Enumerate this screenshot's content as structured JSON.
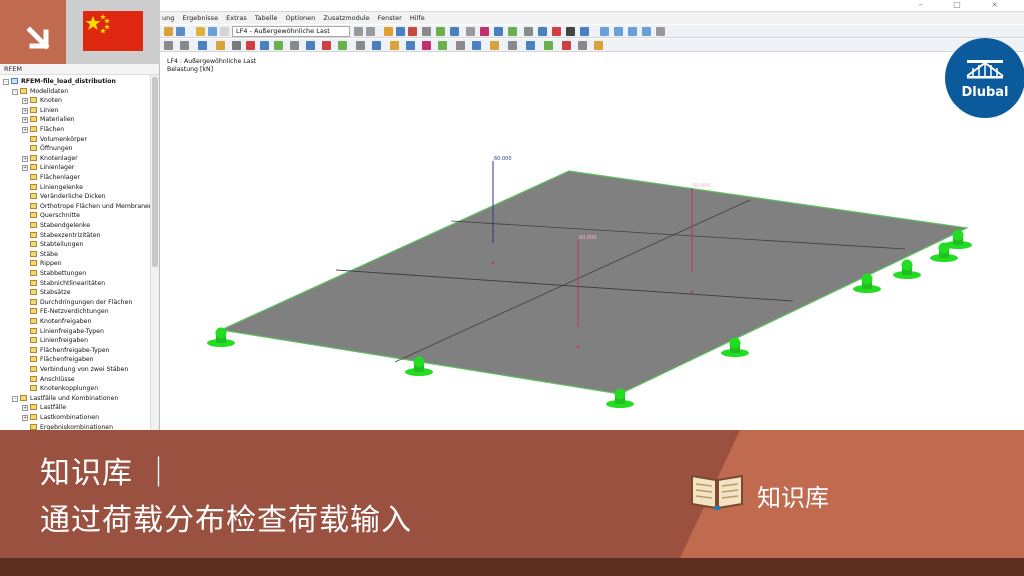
{
  "window": {
    "controls": [
      "–",
      "□",
      "×"
    ]
  },
  "menu": {
    "items": [
      "ung",
      "Ergebnisse",
      "Extras",
      "Tabelle",
      "Optionen",
      "Zusatzmodule",
      "Fenster",
      "Hilfe"
    ]
  },
  "toolbar": {
    "load_case_combo": "LF4 - Außergewöhnliche Last"
  },
  "navigator": {
    "header": "RFEM",
    "root": "RFEM-file_load_distribution",
    "items": [
      {
        "label": "Modelldaten",
        "level": 1,
        "exp": "-"
      },
      {
        "label": "Knoten",
        "level": 2,
        "exp": "+"
      },
      {
        "label": "Linien",
        "level": 2,
        "exp": "+"
      },
      {
        "label": "Materialien",
        "level": 2,
        "exp": "+"
      },
      {
        "label": "Flächen",
        "level": 2,
        "exp": "+"
      },
      {
        "label": "Volumenkörper",
        "level": 2,
        "exp": ""
      },
      {
        "label": "Öffnungen",
        "level": 2,
        "exp": ""
      },
      {
        "label": "Knotenlager",
        "level": 2,
        "exp": "+"
      },
      {
        "label": "Linienlager",
        "level": 2,
        "exp": "+"
      },
      {
        "label": "Flächenlager",
        "level": 2,
        "exp": ""
      },
      {
        "label": "Liniengelenke",
        "level": 2,
        "exp": ""
      },
      {
        "label": "Veränderliche Dicken",
        "level": 2,
        "exp": ""
      },
      {
        "label": "Orthotrope Flächen und Membranen",
        "level": 2,
        "exp": ""
      },
      {
        "label": "Querschnitte",
        "level": 2,
        "exp": ""
      },
      {
        "label": "Stabendgelenke",
        "level": 2,
        "exp": ""
      },
      {
        "label": "Stabexzentrizitäten",
        "level": 2,
        "exp": ""
      },
      {
        "label": "Stabteilungen",
        "level": 2,
        "exp": ""
      },
      {
        "label": "Stäbe",
        "level": 2,
        "exp": ""
      },
      {
        "label": "Rippen",
        "level": 2,
        "exp": ""
      },
      {
        "label": "Stabbettungen",
        "level": 2,
        "exp": ""
      },
      {
        "label": "Stabnichtlinearitäten",
        "level": 2,
        "exp": ""
      },
      {
        "label": "Stabsätze",
        "level": 2,
        "exp": ""
      },
      {
        "label": "Durchdringungen der Flächen",
        "level": 2,
        "exp": ""
      },
      {
        "label": "FE-Netzverdichtungen",
        "level": 2,
        "exp": ""
      },
      {
        "label": "Knotenfreigaben",
        "level": 2,
        "exp": ""
      },
      {
        "label": "Linienfreigabe-Typen",
        "level": 2,
        "exp": ""
      },
      {
        "label": "Linienfreigaben",
        "level": 2,
        "exp": ""
      },
      {
        "label": "Flächenfreigabe-Typen",
        "level": 2,
        "exp": ""
      },
      {
        "label": "Flächenfreigaben",
        "level": 2,
        "exp": ""
      },
      {
        "label": "Verbindung von zwei Stäben",
        "level": 2,
        "exp": ""
      },
      {
        "label": "Anschlüsse",
        "level": 2,
        "exp": ""
      },
      {
        "label": "Knotenkopplungen",
        "level": 2,
        "exp": ""
      },
      {
        "label": "Lastfälle und Kombinationen",
        "level": 1,
        "exp": "-"
      },
      {
        "label": "Lastfälle",
        "level": 2,
        "exp": "+"
      },
      {
        "label": "Lastkombinationen",
        "level": 2,
        "exp": "+"
      },
      {
        "label": "Ergebniskombinationen",
        "level": 2,
        "exp": ""
      }
    ]
  },
  "viewport": {
    "info_line1": "LF4 : Außergewöhnliche Last",
    "info_line2": "Belastung [kN]",
    "load_labels": [
      "60.000",
      "60.000",
      "60.000"
    ]
  },
  "banner": {
    "line1": "知识库 ｜",
    "line2": "通过荷载分布检查荷载输入",
    "kb_label": "知识库"
  },
  "brand": {
    "name": "Dlubal"
  },
  "colors": {
    "banner_bg": "#9b5140",
    "banner_accent": "#c06b4f",
    "slab": "#808080",
    "support": "#22dd22",
    "load": "#c0306a",
    "dlubal_blue": "#0b5a9c"
  }
}
